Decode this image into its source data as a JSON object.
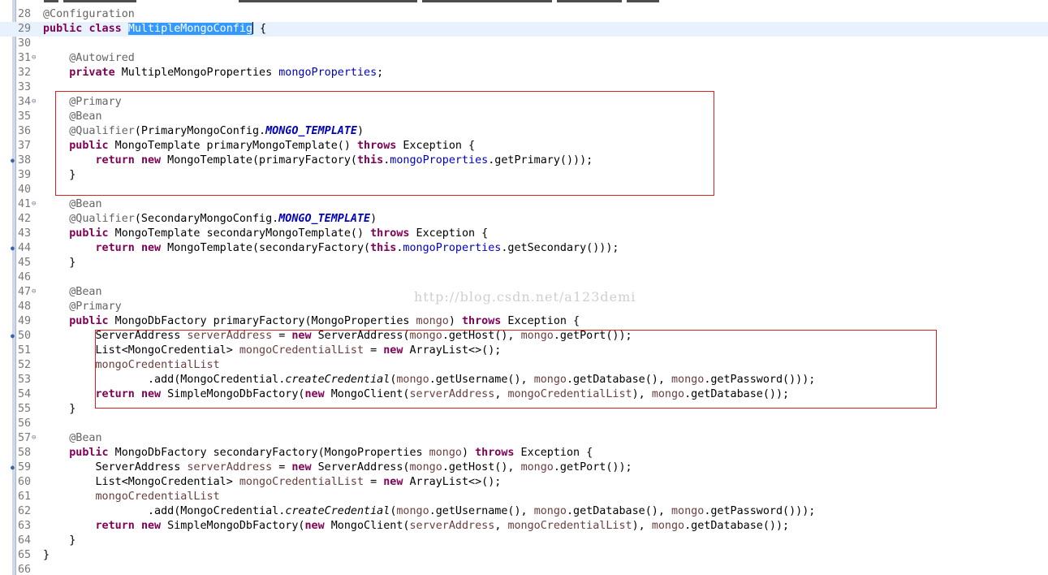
{
  "editor": {
    "watermark": "http://blog.csdn.net/a123demi",
    "lines": [
      {
        "n": "28",
        "text": ""
      },
      {
        "n": "29",
        "text": ""
      },
      {
        "n": "30",
        "text": ""
      },
      {
        "n": "31",
        "text": ""
      },
      {
        "n": "32",
        "text": ""
      },
      {
        "n": "33",
        "text": ""
      },
      {
        "n": "34",
        "text": ""
      },
      {
        "n": "35",
        "text": ""
      },
      {
        "n": "36",
        "text": ""
      },
      {
        "n": "37",
        "text": ""
      },
      {
        "n": "38",
        "text": ""
      },
      {
        "n": "39",
        "text": ""
      },
      {
        "n": "40",
        "text": ""
      },
      {
        "n": "41",
        "text": ""
      },
      {
        "n": "42",
        "text": ""
      },
      {
        "n": "43",
        "text": ""
      },
      {
        "n": "44",
        "text": ""
      },
      {
        "n": "45",
        "text": ""
      },
      {
        "n": "46",
        "text": ""
      },
      {
        "n": "47",
        "text": ""
      },
      {
        "n": "48",
        "text": ""
      },
      {
        "n": "49",
        "text": ""
      },
      {
        "n": "50",
        "text": ""
      },
      {
        "n": "51",
        "text": ""
      },
      {
        "n": "52",
        "text": ""
      },
      {
        "n": "53",
        "text": ""
      },
      {
        "n": "54",
        "text": ""
      },
      {
        "n": "55",
        "text": ""
      },
      {
        "n": "56",
        "text": ""
      },
      {
        "n": "57",
        "text": ""
      },
      {
        "n": "58",
        "text": ""
      },
      {
        "n": "59",
        "text": ""
      },
      {
        "n": "60",
        "text": ""
      },
      {
        "n": "61",
        "text": ""
      },
      {
        "n": "62",
        "text": ""
      },
      {
        "n": "63",
        "text": ""
      },
      {
        "n": "64",
        "text": ""
      },
      {
        "n": "65",
        "text": ""
      },
      {
        "n": "66",
        "text": ""
      }
    ]
  },
  "code": {
    "l28_ann": "@Configuration",
    "l29_kw1": "public",
    "l29_kw2": "class",
    "l29_name": "MultipleMongoConfig",
    "l29_rest": " {",
    "l31_ann": "@Autowired",
    "l32_kw": "private",
    "l32_type": " MultipleMongoProperties ",
    "l32_field": "mongoProperties",
    "l32_end": ";",
    "l34_ann": "@Primary",
    "l35_ann": "@Bean",
    "l36_ann": "@Qualifier",
    "l36_a": "(PrimaryMongoConfig.",
    "l36_const": "MONGO_TEMPLATE",
    "l36_b": ")",
    "l37_kw": "public",
    "l37_a": " MongoTemplate primaryMongoTemplate() ",
    "l37_kw2": "throws",
    "l37_b": " Exception {",
    "l38_kw": "return",
    "l38_kw2": "new",
    "l38_a": " MongoTemplate(primaryFactory(",
    "l38_kw3": "this",
    "l38_dot": ".",
    "l38_field": "mongoProperties",
    "l38_b": ".getPrimary()));",
    "l39": "}",
    "l41_ann": "@Bean",
    "l42_ann": "@Qualifier",
    "l42_a": "(SecondaryMongoConfig.",
    "l42_const": "MONGO_TEMPLATE",
    "l42_b": ")",
    "l43_kw": "public",
    "l43_a": " MongoTemplate secondaryMongoTemplate() ",
    "l43_kw2": "throws",
    "l43_b": " Exception {",
    "l44_kw": "return",
    "l44_kw2": "new",
    "l44_a": " MongoTemplate(secondaryFactory(",
    "l44_kw3": "this",
    "l44_dot": ".",
    "l44_field": "mongoProperties",
    "l44_b": ".getSecondary()));",
    "l45": "}",
    "l47_ann": "@Bean",
    "l48_ann": "@Primary",
    "l49_kw": "public",
    "l49_a": " MongoDbFactory primaryFactory(MongoProperties ",
    "l49_var": "mongo",
    "l49_b": ") ",
    "l49_kw2": "throws",
    "l49_c": " Exception {",
    "l50_a": "ServerAddress ",
    "l50_var": "serverAddress",
    "l50_b": " = ",
    "l50_kw": "new",
    "l50_c": " ServerAddress(",
    "l50_v2": "mongo",
    "l50_d": ".getHost(), ",
    "l50_v3": "mongo",
    "l50_e": ".getPort());",
    "l51_a": "List<MongoCredential> ",
    "l51_var": "mongoCredentialList",
    "l51_b": " = ",
    "l51_kw": "new",
    "l51_c": " ArrayList<>();",
    "l52_var": "mongoCredentialList",
    "l53_a": ".add(MongoCredential.",
    "l53_static": "createCredential",
    "l53_b": "(",
    "l53_v1": "mongo",
    "l53_c": ".getUsername(), ",
    "l53_v2": "mongo",
    "l53_d": ".getDatabase(), ",
    "l53_v3": "mongo",
    "l53_e": ".getPassword()));",
    "l54_kw": "return",
    "l54_kw2": "new",
    "l54_a": " SimpleMongoDbFactory(",
    "l54_kw3": "new",
    "l54_b": " MongoClient(",
    "l54_v1": "serverAddress",
    "l54_c": ", ",
    "l54_v2": "mongoCredentialList",
    "l54_d": "), ",
    "l54_v3": "mongo",
    "l54_e": ".getDatabase());",
    "l55": "}",
    "l57_ann": "@Bean",
    "l58_kw": "public",
    "l58_a": " MongoDbFactory secondaryFactory(MongoProperties ",
    "l58_var": "mongo",
    "l58_b": ") ",
    "l58_kw2": "throws",
    "l58_c": " Exception {",
    "l59_a": "ServerAddress ",
    "l59_var": "serverAddress",
    "l59_b": " = ",
    "l59_kw": "new",
    "l59_c": " ServerAddress(",
    "l59_v2": "mongo",
    "l59_d": ".getHost(), ",
    "l59_v3": "mongo",
    "l59_e": ".getPort());",
    "l60_a": "List<MongoCredential> ",
    "l60_var": "mongoCredentialList",
    "l60_b": " = ",
    "l60_kw": "new",
    "l60_c": " ArrayList<>();",
    "l61_var": "mongoCredentialList",
    "l62_a": ".add(MongoCredential.",
    "l62_static": "createCredential",
    "l62_b": "(",
    "l62_v1": "mongo",
    "l62_c": ".getUsername(), ",
    "l62_v2": "mongo",
    "l62_d": ".getDatabase(), ",
    "l62_v3": "mongo",
    "l62_e": ".getPassword()));",
    "l63_kw": "return",
    "l63_kw2": "new",
    "l63_a": " SimpleMongoDbFactory(",
    "l63_kw3": "new",
    "l63_b": " MongoClient(",
    "l63_v1": "serverAddress",
    "l63_c": ", ",
    "l63_v2": "mongoCredentialList",
    "l63_d": "), ",
    "l63_v3": "mongo",
    "l63_e": ".getDatabase());",
    "l64": "}",
    "l65": "}"
  },
  "colors": {
    "keyword": "#7f0055",
    "annotation": "#646464",
    "field": "#0000c0",
    "local_var": "#6a3e3e",
    "selection": "#3399ff",
    "highlight_box": "#e02020",
    "current_line": "#e8f2fe"
  },
  "icons": {
    "fold": "fold-collapse-icon",
    "override": "override-marker-icon"
  }
}
